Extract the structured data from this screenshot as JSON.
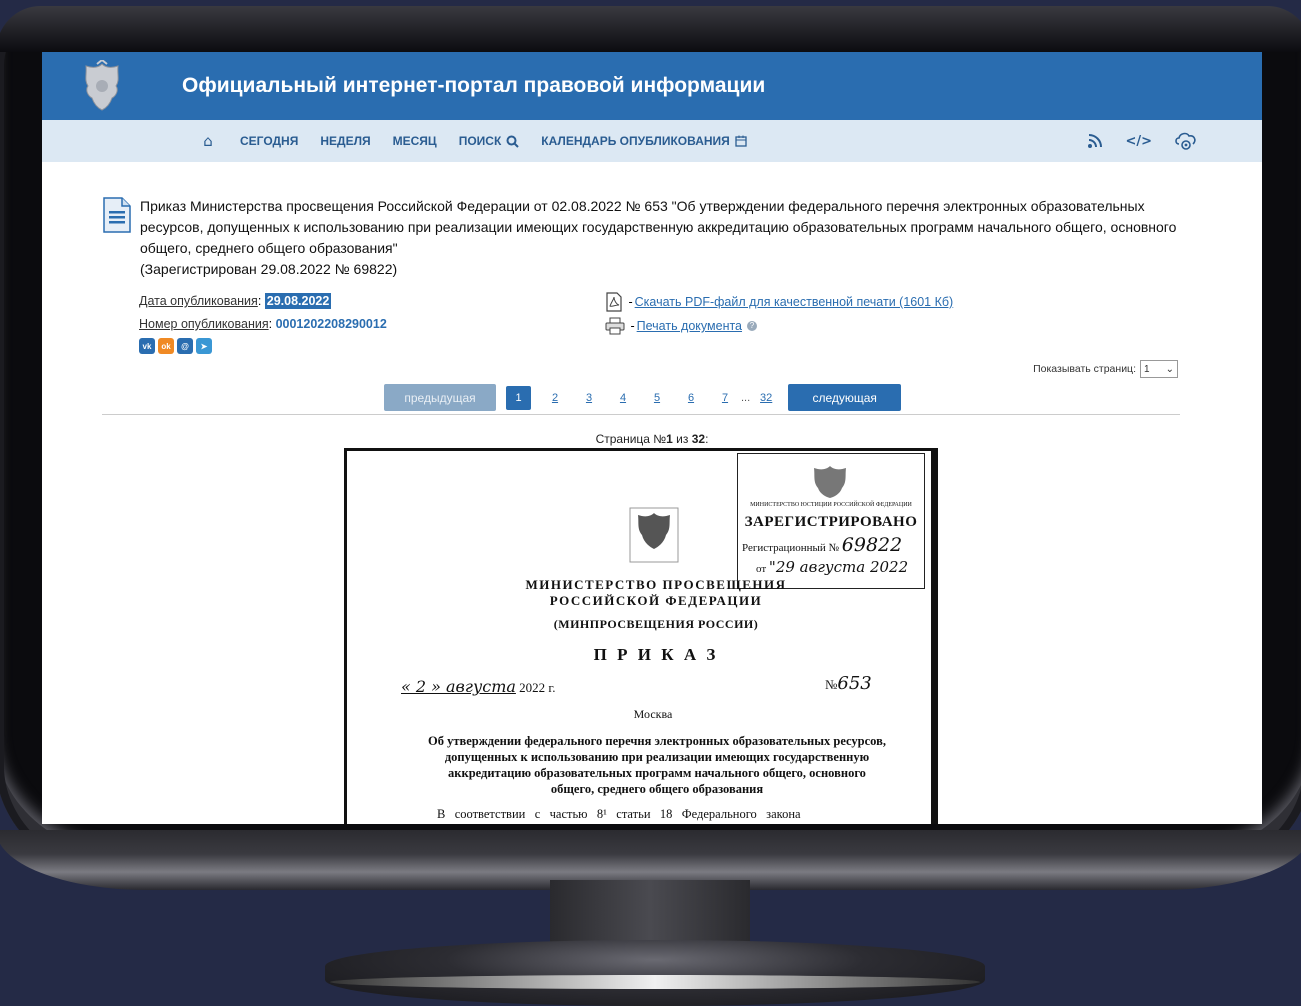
{
  "site": {
    "title": "Официальный интернет-портал правовой информации"
  },
  "nav": {
    "items": [
      {
        "label": "СЕГОДНЯ"
      },
      {
        "label": "НЕДЕЛЯ"
      },
      {
        "label": "МЕСЯЦ"
      },
      {
        "label": "ПОИСК"
      },
      {
        "label": "КАЛЕНДАРЬ ОПУБЛИКОВАНИЯ"
      }
    ],
    "right_icons": [
      "rss-icon",
      "code-icon",
      "settings-cloud-icon"
    ]
  },
  "document": {
    "title": "Приказ Министерства просвещения Российской Федерации от 02.08.2022 № 653 \"Об утверждении федерального перечня электронных образовательных ресурсов, допущенных к использованию при реализации имеющих государственную аккредитацию образовательных программ начального общего, основного общего, среднего общего образования\"",
    "registered": "(Зарегистрирован 29.08.2022 № 69822)",
    "pub_date_label": "Дата опубликования",
    "pub_date": "29.08.2022",
    "pub_number_label": "Номер опубликования",
    "pub_number": "0001202208290012",
    "download_label": "Скачать PDF-файл для качественной печати (1601 Кб)",
    "print_label": "Печать документа"
  },
  "share": [
    "vk",
    "ok",
    "mm",
    "tg"
  ],
  "pagination": {
    "show_pages_label": "Показывать страниц:",
    "show_pages_value": "1",
    "prev_label": "предыдущая",
    "next_label": "следующая",
    "pages": [
      "1",
      "2",
      "3",
      "4",
      "5",
      "6",
      "7"
    ],
    "ellipsis": "...",
    "last": "32",
    "current": "1",
    "caption_prefix": "Страница №",
    "caption_num": "1",
    "caption_mid": " из ",
    "caption_total": "32",
    "caption_suffix": ":"
  },
  "scan": {
    "stamp_line1": "МИНИСТЕРСТВО ЮСТИЦИИ РОССИЙСКОЙ ФЕДЕРАЦИИ",
    "stamp_line2": "ЗАРЕГИСТРИРОВАНО",
    "stamp_reg_label": "Регистрационный №",
    "stamp_reg_num": "69822",
    "stamp_from": "от",
    "stamp_date_hand": "\"29 августа 2022",
    "ministry1": "МИНИСТЕРСТВО ПРОСВЕЩЕНИЯ",
    "ministry2": "РОССИЙСКОЙ ФЕДЕРАЦИИ",
    "ministry3": "(МИНПРОСВЕЩЕНИЯ РОССИИ)",
    "order": "П Р И К А З",
    "date_hand": "« 2 » августа",
    "year": "2022 г.",
    "num_label": "№",
    "num_hand": "653",
    "city": "Москва",
    "heading": "Об утверждении федерального перечня электронных образовательных ресурсов, допущенных к использованию при реализации имеющих государственную аккредитацию образовательных программ начального общего, основного общего, среднего общего образования",
    "body_start": "В   соответствии   с   частью   8¹   статьи   18   Федерального   закона"
  }
}
